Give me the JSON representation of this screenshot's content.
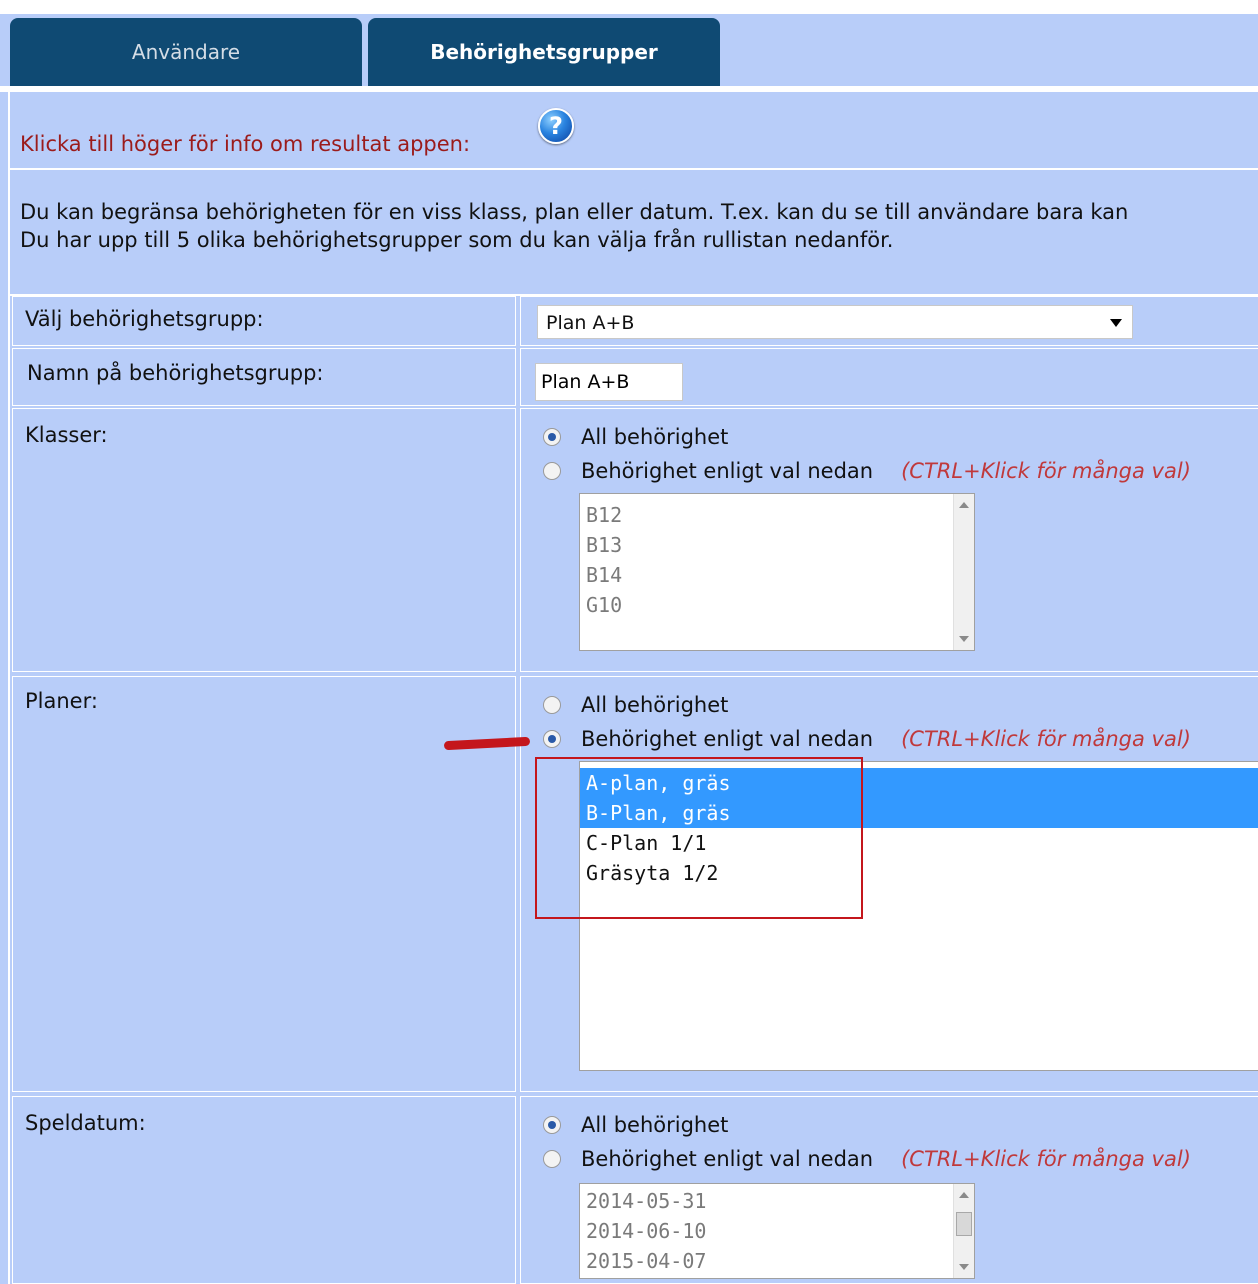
{
  "tabs": [
    {
      "label": "Användare",
      "active": false
    },
    {
      "label": "Behörighetsgrupper",
      "active": true
    }
  ],
  "info": {
    "text": "Klicka till höger för info om resultat appen:",
    "help_icon": "question-circle-icon"
  },
  "description": {
    "line1": "Du kan begränsa behörigheten för en viss klass, plan eller datum. T.ex. kan du se till användare bara kan",
    "line2": "Du har upp till 5 olika behörighetsgrupper som du kan välja från rullistan nedanför."
  },
  "group_select": {
    "label": "Välj behörighetsgrupp:",
    "value": "Plan A+B"
  },
  "group_name": {
    "label": "Namn på behörighetsgrupp:",
    "value": "Plan A+B"
  },
  "klasser": {
    "label": "Klasser:",
    "radio_all": "All behörighet",
    "radio_select": "Behörighet enligt val nedan",
    "hint": "(CTRL+Klick för många val)",
    "selected_option": "all",
    "options": [
      "B12",
      "B13",
      "B14",
      "G10"
    ]
  },
  "planer": {
    "label": "Planer:",
    "radio_all": "All behörighet",
    "radio_select": "Behörighet enligt val nedan",
    "hint": "(CTRL+Klick för många val)",
    "selected_option": "select",
    "options": [
      "A-plan, gräs",
      "B-Plan, gräs",
      "C-Plan 1/1",
      "Gräsyta 1/2"
    ],
    "selected_items": [
      "A-plan, gräs",
      "B-Plan, gräs"
    ]
  },
  "speldatum": {
    "label": "Speldatum:",
    "radio_all": "All behörighet",
    "radio_select": "Behörighet enligt val nedan",
    "hint": "(CTRL+Klick för många val)",
    "selected_option": "all",
    "options": [
      "2014-05-31",
      "2014-06-10",
      "2015-04-07"
    ]
  },
  "colors": {
    "tab_bg": "#0f4a73",
    "page_bg": "#b8cdf9",
    "info_text": "#9b1b1b",
    "hint_text": "#c0393b",
    "selection": "#3399ff",
    "annotation": "#c4161c"
  }
}
